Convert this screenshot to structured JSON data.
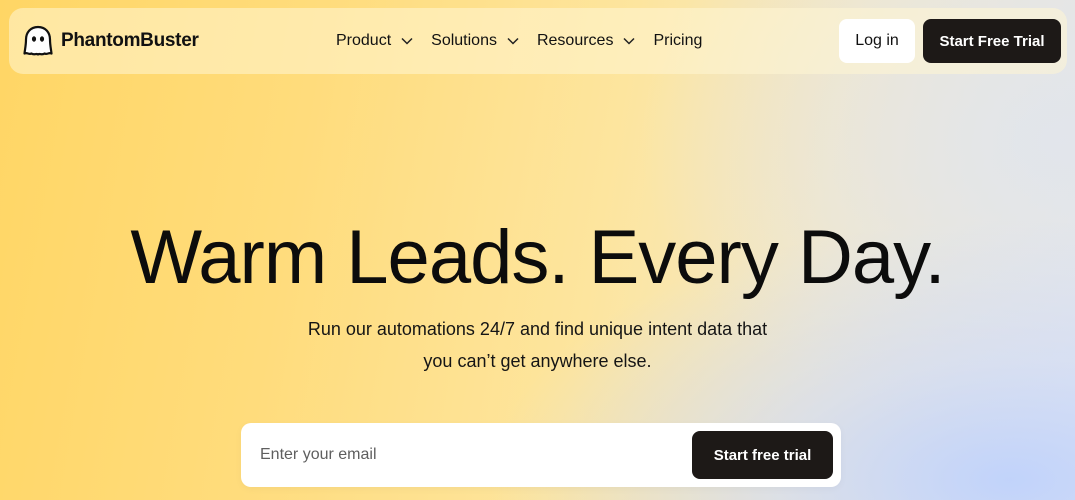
{
  "header": {
    "brand": {
      "name": "PhantomBuster",
      "logo_icon": "ghost-icon"
    },
    "nav": [
      {
        "label": "Product",
        "has_dropdown": true
      },
      {
        "label": "Solutions",
        "has_dropdown": true
      },
      {
        "label": "Resources",
        "has_dropdown": true
      },
      {
        "label": "Pricing",
        "has_dropdown": false
      }
    ],
    "login_label": "Log in",
    "start_trial_label": "Start Free Trial"
  },
  "hero": {
    "title": "Warm Leads. Every Day.",
    "subtitle_line1": "Run our automations 24/7 and find unique intent data that",
    "subtitle_line2": "you can’t get anywhere else."
  },
  "email_form": {
    "placeholder": "Enter your email",
    "value": "",
    "button_label": "Start free trial"
  },
  "colors": {
    "primary_button": "#1d1917",
    "primary_button_text": "#ffffff",
    "gradient_yellow": "#ffd665",
    "gradient_blue": "#bfd2fc"
  }
}
